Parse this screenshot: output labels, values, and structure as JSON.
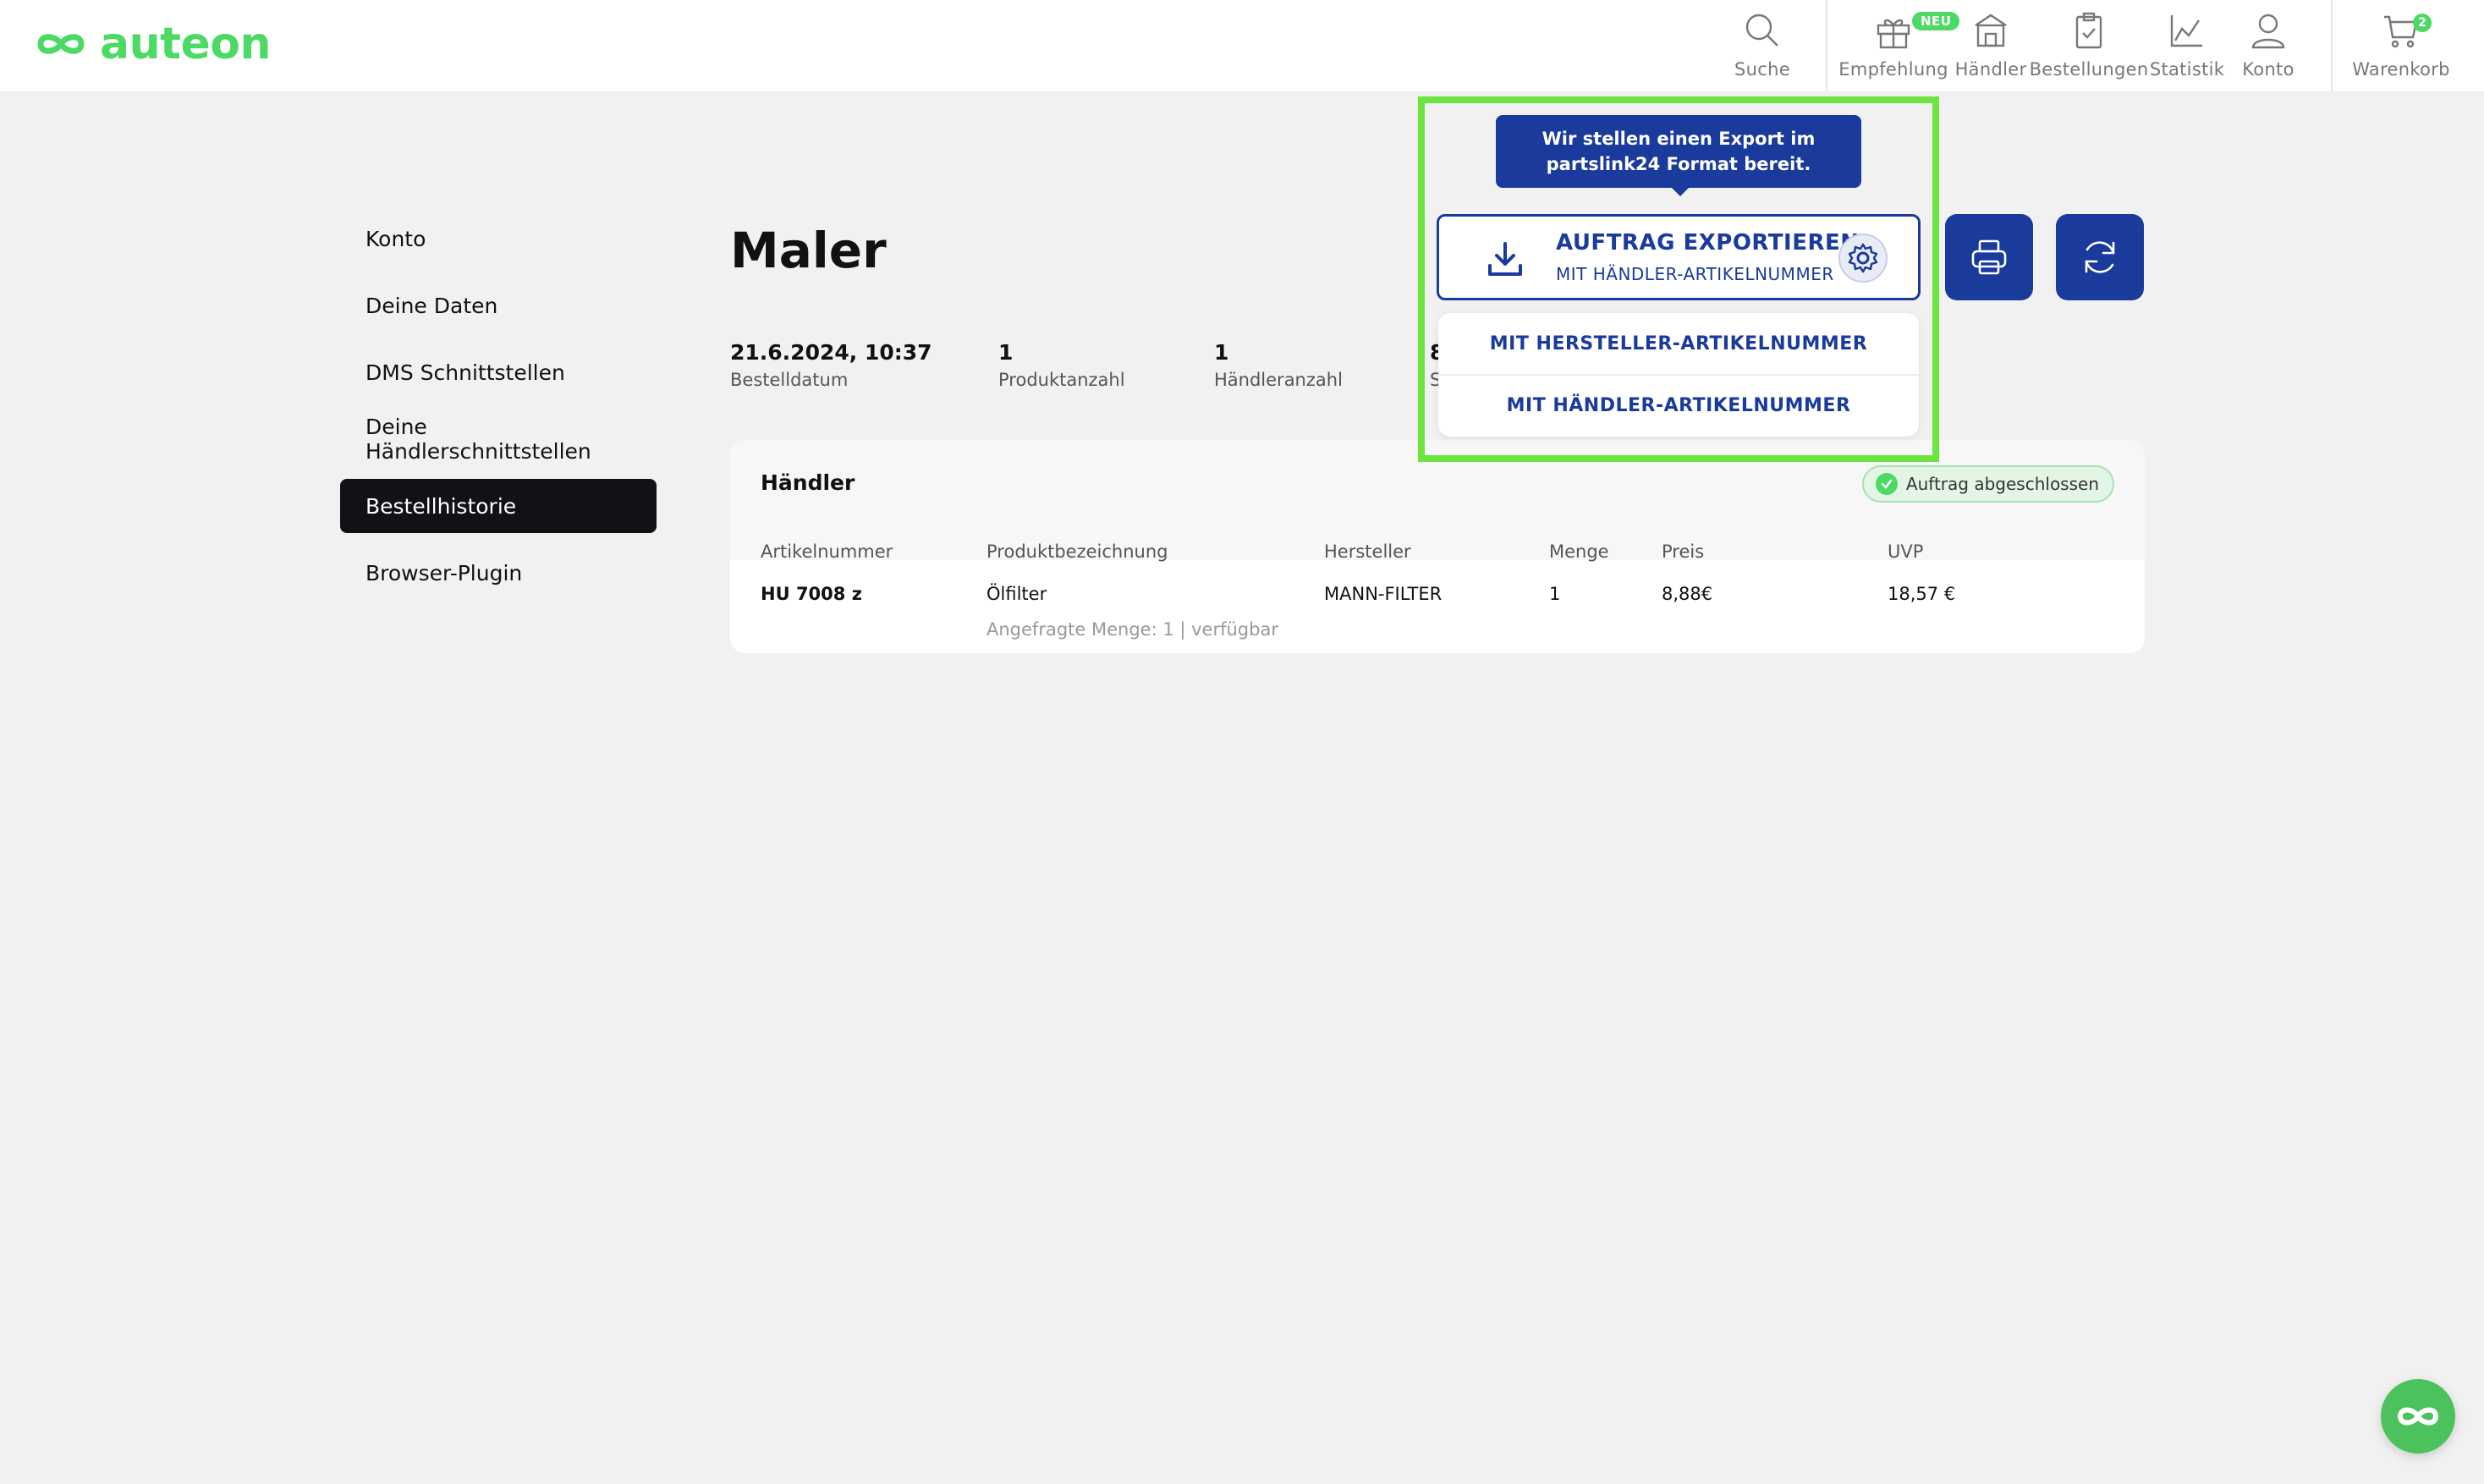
{
  "brand": {
    "name": "auteon",
    "color": "#4cd964"
  },
  "nav": {
    "search": {
      "label": "Suche",
      "icon": "search-icon"
    },
    "recommendation": {
      "label": "Empfehlung",
      "badge": "NEU",
      "icon": "gift-icon"
    },
    "dealers": {
      "label": "Händler",
      "icon": "store-icon"
    },
    "orders": {
      "label": "Bestellungen",
      "icon": "clipboard-check-icon"
    },
    "stats": {
      "label": "Statistik",
      "icon": "chart-icon"
    },
    "account": {
      "label": "Konto",
      "icon": "user-icon"
    },
    "cart": {
      "label": "Warenkorb",
      "count": "2",
      "icon": "cart-icon"
    }
  },
  "sidebar": {
    "items": [
      {
        "label": "Konto"
      },
      {
        "label": "Deine Daten"
      },
      {
        "label": "DMS Schnittstellen"
      },
      {
        "label": "Deine Händlerschnittstellen"
      },
      {
        "label": "Bestellhistorie",
        "active": true
      },
      {
        "label": "Browser-Plugin"
      }
    ]
  },
  "order": {
    "title": "Maler",
    "stats": [
      {
        "value": "21.6.2024, 10:37",
        "label": "Bestelldatum"
      },
      {
        "value": "1",
        "label": "Produktanzahl"
      },
      {
        "value": "1",
        "label": "Händleranzahl"
      },
      {
        "value": "8",
        "label": "S"
      }
    ],
    "dealer_section": {
      "title": "Händler",
      "status": "Auftrag abgeschlossen",
      "columns": [
        "Artikelnummer",
        "Produktbezeichnung",
        "Hersteller",
        "Menge",
        "Preis",
        "UVP"
      ],
      "rows": [
        {
          "article": "HU 7008 z",
          "product": "Ölfilter",
          "manufacturer": "MANN-FILTER",
          "quantity": "1",
          "price": "8,88€",
          "uvp": "18,57 €",
          "note": "Angefragte Menge: 1 | verfügbar"
        }
      ]
    }
  },
  "export": {
    "tooltip_line1": "Wir stellen einen Export im",
    "tooltip_line2": "partslink24 Format bereit.",
    "button_main": "AUFTRAG EXPORTIEREN",
    "button_sub": "MIT HÄNDLER-ARTIKELNUMMER",
    "options": [
      "MIT HERSTELLER-ARTIKELNUMMER",
      "MIT HÄNDLER-ARTIKELNUMMER"
    ],
    "accent_color": "#1a3a9c",
    "highlight_color": "#6ce540"
  }
}
